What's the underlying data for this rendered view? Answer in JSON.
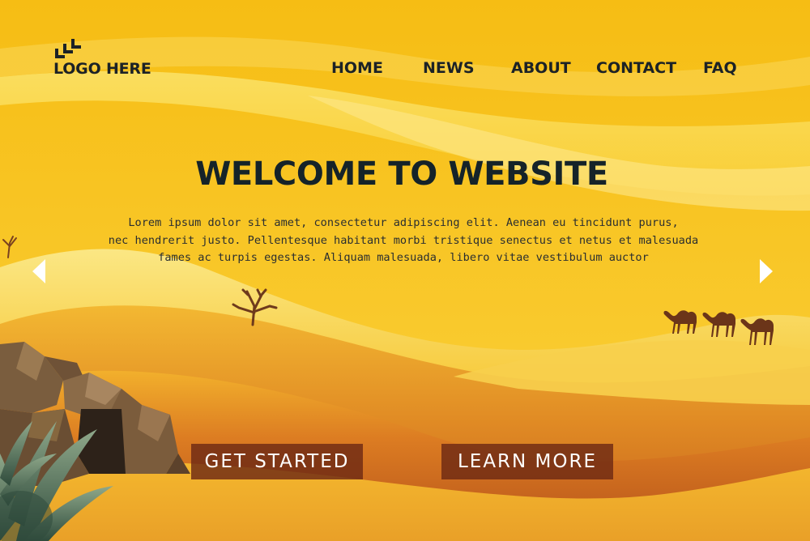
{
  "brand": {
    "logo_text": "LOGO HERE",
    "logo_icon": "stacked-chevron-logo-icon"
  },
  "nav": {
    "items": [
      {
        "label": "HOME"
      },
      {
        "label": "NEWS"
      },
      {
        "label": "ABOUT"
      },
      {
        "label": "CONTACT"
      },
      {
        "label": "FAQ"
      }
    ]
  },
  "hero": {
    "title": "WELCOME TO WEBSITE",
    "body_lines": [
      "Lorem ipsum dolor sit amet, consectetur adipiscing elit. Aenean eu tincidunt purus,",
      "nec hendrerit justo. Pellentesque habitant morbi tristique senectus et netus et malesuada",
      "fames ac turpis egestas. Aliquam malesuada, libero vitae vestibulum auctor"
    ],
    "prev_icon": "chevron-left-icon",
    "next_icon": "chevron-right-icon"
  },
  "actions": {
    "get_started": "GET STARTED",
    "learn_more": "LEARN MORE"
  },
  "illustration": {
    "scene": "desert-dunes-illustration",
    "elements": [
      "bare-tree-icon",
      "camel-icon",
      "rock-cave-icon",
      "agave-plant-icon"
    ]
  },
  "colors": {
    "sky": "#f7c21c",
    "dune_light": "#f9dc68",
    "dune_deep": "#b8561a",
    "text_dark": "#152329",
    "button_bg": "#6e2a14",
    "button_text": "#ffffff"
  }
}
